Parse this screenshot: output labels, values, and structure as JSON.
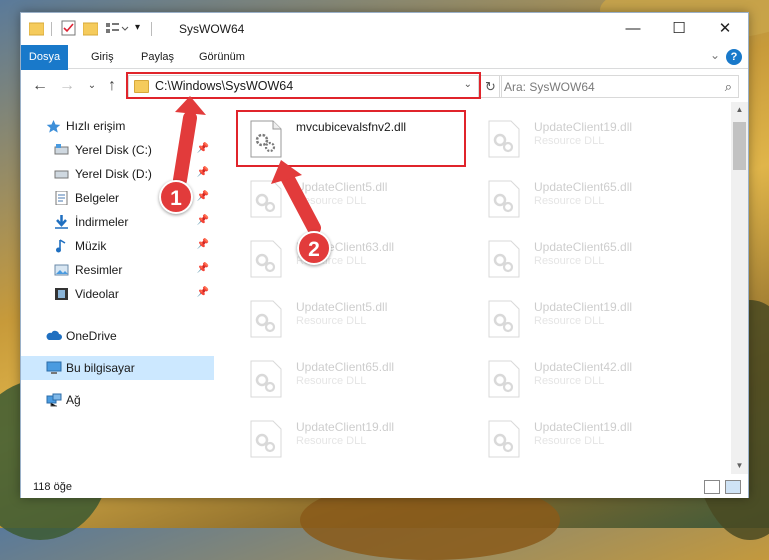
{
  "window": {
    "title": "SysWOW64",
    "controls": {
      "minimize": "—",
      "maximize": "☐",
      "close": "✕"
    }
  },
  "ribbon": {
    "tabs": [
      "Dosya",
      "Giriş",
      "Paylaş",
      "Görünüm"
    ],
    "help": "?",
    "collapse": "⌄"
  },
  "address": {
    "path": "C:\\Windows\\SysWOW64",
    "dropdown": "⌄",
    "refresh": "↻",
    "search_placeholder": "Ara: SysWOW64",
    "search_icon": "⌕",
    "back": "←",
    "forward": "→",
    "recent": "⌄",
    "up": "↑"
  },
  "nav": {
    "items": [
      {
        "label": "Hızlı erişim",
        "icon": "star-icon",
        "pinned": false,
        "indent": 1
      },
      {
        "label": "Yerel Disk (C:)",
        "icon": "drive-icon",
        "pinned": true,
        "indent": 2
      },
      {
        "label": "Yerel Disk (D:)",
        "icon": "drive-icon",
        "pinned": true,
        "indent": 2
      },
      {
        "label": "Belgeler",
        "icon": "documents-icon",
        "pinned": true,
        "indent": 2
      },
      {
        "label": "İndirmeler",
        "icon": "download-icon",
        "pinned": true,
        "indent": 2
      },
      {
        "label": "Müzik",
        "icon": "music-icon",
        "pinned": true,
        "indent": 2
      },
      {
        "label": "Resimler",
        "icon": "pictures-icon",
        "pinned": true,
        "indent": 2
      },
      {
        "label": "Videolar",
        "icon": "videos-icon",
        "pinned": true,
        "indent": 2
      },
      {
        "label": "OneDrive",
        "icon": "cloud-icon",
        "pinned": false,
        "indent": 1
      },
      {
        "label": "Bu bilgisayar",
        "icon": "computer-icon",
        "pinned": false,
        "indent": 1,
        "selected": true
      },
      {
        "label": "Ağ",
        "icon": "network-icon",
        "pinned": false,
        "indent": 1
      }
    ],
    "pin_glyph": "📌"
  },
  "files": {
    "type_label": "Resource DLL",
    "left": [
      "mvcubicevalsfnv2.dll",
      "UpdateClient5.dll",
      "UpdateClient63.dll",
      "UpdateClient5.dll",
      "UpdateClient65.dll",
      "UpdateClient19.dll"
    ],
    "right": [
      "UpdateClient19.dll",
      "UpdateClient65.dll",
      "UpdateClient65.dll",
      "UpdateClient19.dll",
      "UpdateClient42.dll",
      "UpdateClient19.dll"
    ]
  },
  "status": {
    "count": "118 öğe"
  },
  "annotations": {
    "badge1": "1",
    "badge2": "2",
    "color": "#e0242b"
  }
}
